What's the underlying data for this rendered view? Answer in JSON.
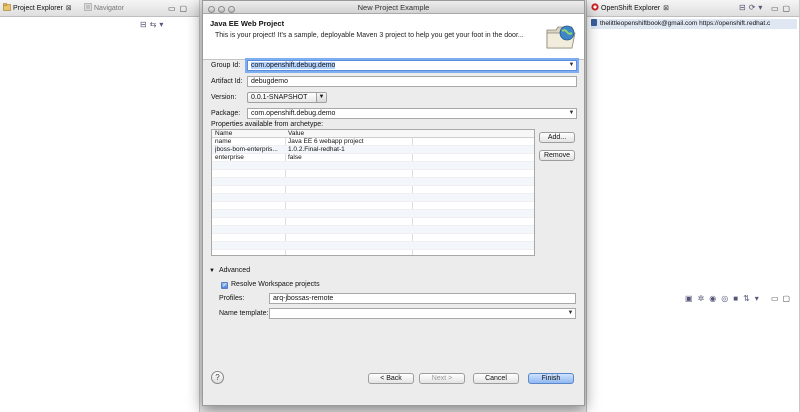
{
  "left_pane": {
    "tab_active": "Project Explorer",
    "tab_inactive": "Navigator",
    "close_symbol": "⊠"
  },
  "right_pane": {
    "tab_active": "OpenShift Explorer",
    "close_symbol": "⊠",
    "row_text": "thelittleopenshiftbook@gmail.com https://openshift.redhat.c"
  },
  "dialog": {
    "window_title": "New Project Example",
    "banner_title": "Java EE Web Project",
    "banner_description": "This is your project! It's a sample, deployable Maven 3 project to help you get your foot in the door...",
    "group_id": {
      "label": "Group Id:",
      "value": "com.openshift.debug.demo"
    },
    "artifact_id": {
      "label": "Artifact Id:",
      "value": "debugdemo"
    },
    "version": {
      "label": "Version:",
      "value": "0.0.1-SNAPSHOT"
    },
    "package": {
      "label": "Package:",
      "value": "com.openshift.debug.demo"
    },
    "properties": {
      "label": "Properties available from archetype:",
      "columns": [
        "Name",
        "Value"
      ],
      "rows": [
        {
          "name": "name",
          "value": "Java EE 6 webapp project"
        },
        {
          "name": "jboss-bom-enterpris...",
          "value": "1.0.2.Final-redhat-1"
        },
        {
          "name": "enterprise",
          "value": "false"
        }
      ],
      "empty_rows": 12
    },
    "add_button": "Add...",
    "remove_button": "Remove",
    "advanced": {
      "label": "Advanced",
      "resolve_workspace": {
        "label": "Resolve Workspace projects",
        "checked": true
      },
      "profiles": {
        "label": "Profiles:",
        "value": "arq-jbossas-remote"
      },
      "name_template": {
        "label": "Name template:",
        "value": ""
      }
    },
    "buttons": {
      "help": "?",
      "back": "< Back",
      "next": "Next >",
      "cancel": "Cancel",
      "finish": "Finish"
    }
  },
  "colors": {
    "focus_ring": "#7eaef0",
    "default_button": "#8fb8f0",
    "openshift_red": "#cc1f1f"
  }
}
